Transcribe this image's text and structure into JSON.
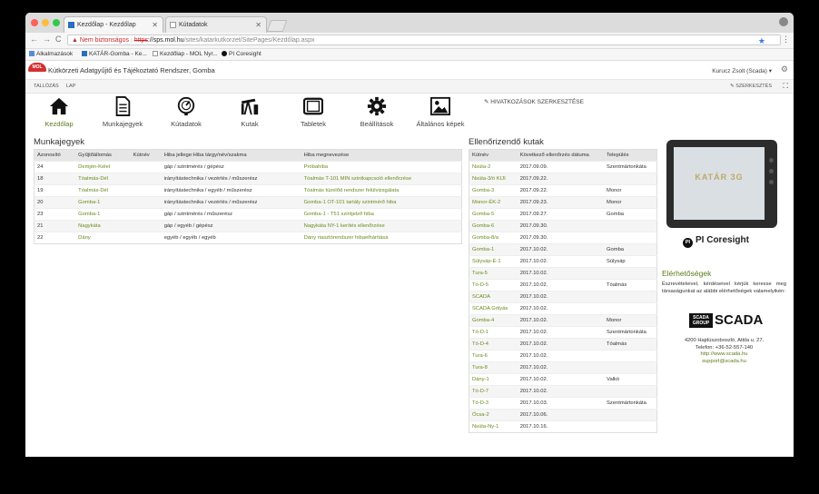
{
  "browser": {
    "tabs": [
      {
        "title": "Kezdőlap - Kezdőlap",
        "active": true
      },
      {
        "title": "Kútadatok",
        "active": false
      }
    ],
    "address": {
      "warning": "Nem biztonságos",
      "scheme": "https",
      "host": "://sps.mol.hu",
      "path": "/sites/katarkutkorzet/SitePages/Kezdőlap.aspx"
    },
    "bookmarks": [
      "Alkalmazások",
      "KATÁR-Gomba - Ke...",
      "Kezdőlap - MOL Nyr...",
      "PI Coresight"
    ]
  },
  "site": {
    "logo": "MOL",
    "title": "Kútkörzeti Adatgyűjtő és Tájékoztató Rendszer, Gomba",
    "user": "Kurucz Zsolt (Scada) ▾",
    "ribbon_tabs": [
      "TALLÓZÁS",
      "LAP"
    ],
    "edit_label": "SZERKESZTÉS",
    "edit_links_label": "HIVATKOZÁSOK SZERKESZTÉSE"
  },
  "nav": [
    {
      "label": "Kezdőlap",
      "icon": "home-icon"
    },
    {
      "label": "Munkajegyek",
      "icon": "document-icon"
    },
    {
      "label": "Kútadatok",
      "icon": "gauge-icon"
    },
    {
      "label": "Kutak",
      "icon": "pumpjack-icon"
    },
    {
      "label": "Tabletek",
      "icon": "tablet-icon"
    },
    {
      "label": "Beállítások",
      "icon": "gear-icon"
    },
    {
      "label": "Általános képek",
      "icon": "image-icon"
    }
  ],
  "munkajegyek": {
    "title": "Munkajegyek",
    "columns": [
      "Azonosító",
      "Gyűjtőállomás",
      "Kútnév",
      "Hiba jellege:Hiba tárgy/név/szakma",
      "Hiba megnevezése"
    ],
    "rows": [
      [
        "24",
        "Demjén-Kelet",
        "",
        "gáp / szintmérés / gépész",
        "Próbahiba"
      ],
      [
        "18",
        "Tóalmás-Dél",
        "",
        "irányítástechnika / vezérlés / műszerész",
        "Tóalmás T-101 MIN szintkapcsoló ellenőrzése"
      ],
      [
        "19",
        "Tóalmás-Dél",
        "",
        "irányítástechnika / egyéb / műszerész",
        "Tóalmás tüzelőd rendszer felülvizsgálata"
      ],
      [
        "20",
        "Gomba-1",
        "",
        "irányítástechnika / vezérlés / műszerész",
        "Gomba-1 OT-101 tartály szintmérő hiba"
      ],
      [
        "23",
        "Gomba-1",
        "",
        "gáp / szintmérés / műszerész",
        "Gomba-1 - T51 szintjelző hiba"
      ],
      [
        "21",
        "Nagykáta",
        "",
        "gáp / egyéb / gépész",
        "Nagykáta NY-1 kerítés ellenőrzése"
      ],
      [
        "22",
        "Dány",
        "",
        "egyéb / egyéb / egyéb",
        "Dány riasztórendszer hibaelhárítása"
      ]
    ]
  },
  "ellenorizendo": {
    "title": "Ellenőrizendő kutak",
    "columns": [
      "Kútnév",
      "Következő ellenőrzés dátuma",
      "Település"
    ],
    "rows": [
      [
        "Nsüta-2",
        "2017.09.09.",
        "Szentmártonkáta"
      ],
      [
        "Nsüta-3/ö KIJI",
        "2017.09.22.",
        ""
      ],
      [
        "Gomba-3",
        "2017.09.22.",
        "Monor"
      ],
      [
        "Monor-ÉK-2",
        "2017.09.23.",
        "Monor"
      ],
      [
        "Gomba-5",
        "2017.09.27.",
        "Gomba"
      ],
      [
        "Gomba-6",
        "2017.09.30.",
        ""
      ],
      [
        "Gomba-8/a",
        "2017.09.30.",
        ""
      ],
      [
        "Gomba-1",
        "2017.10.02.",
        "Gomba"
      ],
      [
        "Súlysáp-É-1",
        "2017.10.02.",
        "Súlysáp"
      ],
      [
        "Tura-5",
        "2017.10.02.",
        ""
      ],
      [
        "Tó-D-5",
        "2017.10.02.",
        "Tóalmás"
      ],
      [
        "SCADA",
        "2017.10.02.",
        ""
      ],
      [
        "SCADA Gólyás",
        "2017.10.02.",
        ""
      ],
      [
        "Gomba-4",
        "2017.10.02.",
        "Monor"
      ],
      [
        "Tó-D-1",
        "2017.10.02.",
        "Szentmártonkáta"
      ],
      [
        "Tó-D-4",
        "2017.10.02.",
        "Tóalmás"
      ],
      [
        "Tura-6",
        "2017.10.02.",
        ""
      ],
      [
        "Tura-8",
        "2017.10.02.",
        ""
      ],
      [
        "Dány-1",
        "2017.10.02.",
        "Valkó"
      ],
      [
        "Tó-D-7",
        "2017.10.02.",
        ""
      ],
      [
        "Tó-D-3",
        "2017.10.03.",
        "Szentmártonkáta"
      ],
      [
        "Ócsa-2",
        "2017.10.06.",
        ""
      ],
      [
        "Nsüta-Ny-1",
        "2017.10.16.",
        ""
      ]
    ]
  },
  "sidebar": {
    "tablet_screen_text": "KATÁR 3G",
    "pi_logo": "PI Coresight",
    "contact_title": "Elérhetőségek",
    "contact_text": "Észrevételeivel, kérdéseivel kérjük keresse meg társaságunkat az alábbi elérhetőségek valamelyikén:",
    "scada_box": "SCADA GROUP",
    "scada_big": "SCADA",
    "address_line": "4200 Hajdúszoboszló, Attila u. 27.",
    "phone": "Telefon: +36-52-557-140",
    "web": "http://www.scada.hu",
    "email": "support@scada.hu"
  },
  "colors": {
    "link": "#6a8a1e",
    "accent": "#5a7a1a",
    "logo": "#d32f2f"
  }
}
